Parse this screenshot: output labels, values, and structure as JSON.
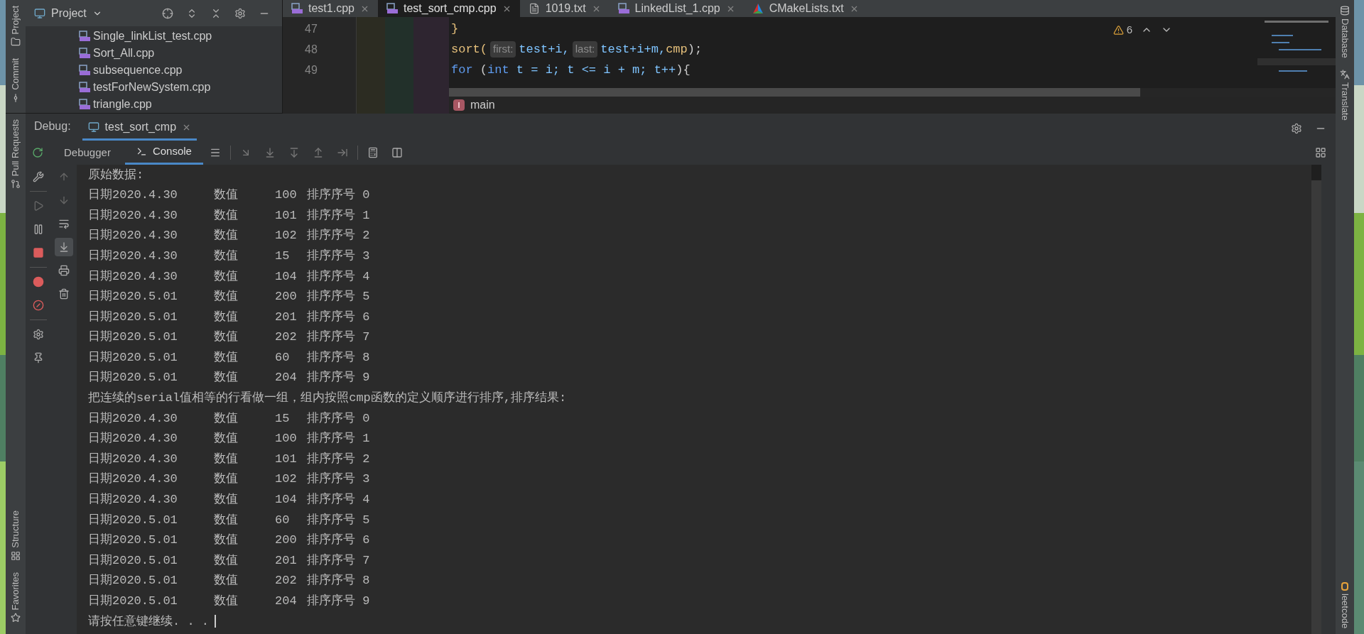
{
  "left_stripe": {
    "tools_top": [
      {
        "label": "Project"
      },
      {
        "label": "Commit"
      },
      {
        "label": "Pull Requests"
      }
    ],
    "tools_bottom": [
      {
        "label": "Structure"
      },
      {
        "label": "Favorites"
      }
    ]
  },
  "project_panel": {
    "title": "Project",
    "files": [
      {
        "name": "Single_linkList_test.cpp"
      },
      {
        "name": "Sort_All.cpp"
      },
      {
        "name": "subsequence.cpp"
      },
      {
        "name": "testForNewSystem.cpp"
      },
      {
        "name": "triangle.cpp"
      }
    ]
  },
  "editor": {
    "tabs": [
      {
        "label": "test1.cpp",
        "kind": "cpp",
        "selected": false
      },
      {
        "label": "test_sort_cmp.cpp",
        "kind": "cpp",
        "selected": true
      },
      {
        "label": "1019.txt",
        "kind": "txt",
        "selected": false
      },
      {
        "label": "LinkedList_1.cpp",
        "kind": "cpp",
        "selected": false
      },
      {
        "label": "CMakeLists.txt",
        "kind": "cmake",
        "selected": false
      }
    ],
    "warnings": "6",
    "lines": [
      {
        "number": "47",
        "tokens": [
          {
            "kind": "function",
            "text": "}"
          }
        ]
      },
      {
        "number": "48",
        "tokens": [
          {
            "kind": "function",
            "text": "sort("
          },
          {
            "kind": "hint",
            "text": "first:"
          },
          {
            "kind": "variable",
            "text": "test+i,"
          },
          {
            "kind": "hint",
            "text": "last:"
          },
          {
            "kind": "variable",
            "text": "test+i+m,"
          },
          {
            "kind": "function",
            "text": "cmp"
          },
          {
            "kind": "plain",
            "text": ");"
          }
        ]
      },
      {
        "number": "49",
        "tokens": [
          {
            "kind": "keyword",
            "text": "for"
          },
          {
            "kind": "plain",
            "text": " ("
          },
          {
            "kind": "keyword",
            "text": "int"
          },
          {
            "kind": "variable",
            "text": " t = i; t <= i + m; t++"
          },
          {
            "kind": "plain",
            "text": "){"
          }
        ]
      }
    ],
    "breadcrumb": "main"
  },
  "right_stripe": {
    "tools": [
      {
        "label": "Database"
      },
      {
        "label": "Translate"
      }
    ],
    "bottom_tool": {
      "label": "leetcode"
    }
  },
  "debug": {
    "label": "Debug:",
    "session": "test_sort_cmp",
    "tabs": [
      {
        "label": "Debugger",
        "selected": false
      },
      {
        "label": "Console",
        "selected": true
      }
    ],
    "console": [
      {
        "kind": "text",
        "text": "原始数据:"
      },
      {
        "kind": "record",
        "date": "日期2020.4.30",
        "label": "数值",
        "value": "100",
        "order": "排序序号 0"
      },
      {
        "kind": "record",
        "date": "日期2020.4.30",
        "label": "数值",
        "value": "101",
        "order": "排序序号 1"
      },
      {
        "kind": "record",
        "date": "日期2020.4.30",
        "label": "数值",
        "value": "102",
        "order": "排序序号 2"
      },
      {
        "kind": "record",
        "date": "日期2020.4.30",
        "label": "数值",
        "value": "15",
        "order": "排序序号 3"
      },
      {
        "kind": "record",
        "date": "日期2020.4.30",
        "label": "数值",
        "value": "104",
        "order": "排序序号 4"
      },
      {
        "kind": "record",
        "date": "日期2020.5.01",
        "label": "数值",
        "value": "200",
        "order": "排序序号 5"
      },
      {
        "kind": "record",
        "date": "日期2020.5.01",
        "label": "数值",
        "value": "201",
        "order": "排序序号 6"
      },
      {
        "kind": "record",
        "date": "日期2020.5.01",
        "label": "数值",
        "value": "202",
        "order": "排序序号 7"
      },
      {
        "kind": "record",
        "date": "日期2020.5.01",
        "label": "数值",
        "value": "60",
        "order": "排序序号 8"
      },
      {
        "kind": "record",
        "date": "日期2020.5.01",
        "label": "数值",
        "value": "204",
        "order": "排序序号 9"
      },
      {
        "kind": "text",
        "text": "把连续的serial值相等的行看做一组，组内按照cmp函数的定义顺序进行排序,排序结果:"
      },
      {
        "kind": "record",
        "date": "日期2020.4.30",
        "label": "数值",
        "value": "15",
        "order": "排序序号 0"
      },
      {
        "kind": "record",
        "date": "日期2020.4.30",
        "label": "数值",
        "value": "100",
        "order": "排序序号 1"
      },
      {
        "kind": "record",
        "date": "日期2020.4.30",
        "label": "数值",
        "value": "101",
        "order": "排序序号 2"
      },
      {
        "kind": "record",
        "date": "日期2020.4.30",
        "label": "数值",
        "value": "102",
        "order": "排序序号 3"
      },
      {
        "kind": "record",
        "date": "日期2020.4.30",
        "label": "数值",
        "value": "104",
        "order": "排序序号 4"
      },
      {
        "kind": "record",
        "date": "日期2020.5.01",
        "label": "数值",
        "value": "60",
        "order": "排序序号 5"
      },
      {
        "kind": "record",
        "date": "日期2020.5.01",
        "label": "数值",
        "value": "200",
        "order": "排序序号 6"
      },
      {
        "kind": "record",
        "date": "日期2020.5.01",
        "label": "数值",
        "value": "201",
        "order": "排序序号 7"
      },
      {
        "kind": "record",
        "date": "日期2020.5.01",
        "label": "数值",
        "value": "202",
        "order": "排序序号 8"
      },
      {
        "kind": "record",
        "date": "日期2020.5.01",
        "label": "数值",
        "value": "204",
        "order": "排序序号 9"
      },
      {
        "kind": "prompt",
        "text": "请按任意键继续. . ."
      }
    ]
  }
}
